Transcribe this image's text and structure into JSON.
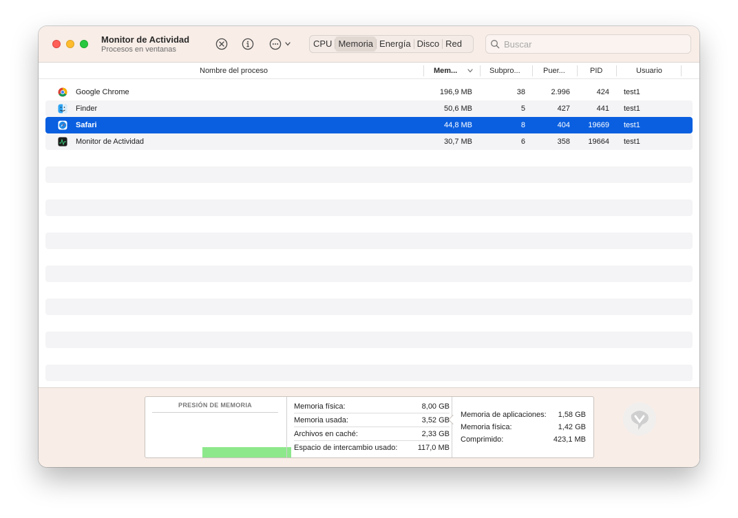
{
  "window": {
    "title": "Monitor de Actividad",
    "subtitle": "Procesos en ventanas"
  },
  "toolbar": {
    "stop_icon": "x-circle-icon",
    "info_icon": "info-circle-icon",
    "more_icon": "ellipsis-circle-icon",
    "tabs": [
      {
        "label": "CPU",
        "active": false
      },
      {
        "label": "Memoria",
        "active": true
      },
      {
        "label": "Energía",
        "active": false
      },
      {
        "label": "Disco",
        "active": false
      },
      {
        "label": "Red",
        "active": false
      }
    ],
    "search_placeholder": "Buscar",
    "search_value": ""
  },
  "table": {
    "columns": [
      {
        "key": "name",
        "label": "Nombre del proceso"
      },
      {
        "key": "mem",
        "label": "Mem...",
        "sorted": "descending"
      },
      {
        "key": "threads",
        "label": "Subpro..."
      },
      {
        "key": "ports",
        "label": "Puer..."
      },
      {
        "key": "pid",
        "label": "PID"
      },
      {
        "key": "user",
        "label": "Usuario"
      }
    ],
    "rows": [
      {
        "icon": "chrome-icon",
        "name": "Google Chrome",
        "mem": "196,9 MB",
        "threads": "38",
        "ports": "2.996",
        "pid": "424",
        "user": "test1",
        "selected": false
      },
      {
        "icon": "finder-icon",
        "name": "Finder",
        "mem": "50,6 MB",
        "threads": "5",
        "ports": "427",
        "pid": "441",
        "user": "test1",
        "selected": false
      },
      {
        "icon": "safari-icon",
        "name": "Safari",
        "mem": "44,8 MB",
        "threads": "8",
        "ports": "404",
        "pid": "19669",
        "user": "test1",
        "selected": true
      },
      {
        "icon": "activity-monitor-icon",
        "name": "Monitor de Actividad",
        "mem": "30,7 MB",
        "threads": "6",
        "ports": "358",
        "pid": "19664",
        "user": "test1",
        "selected": false
      }
    ]
  },
  "footer": {
    "pressure_title": "PRESIÓN DE MEMORIA",
    "pressure_color": "#8de88b",
    "stats": [
      {
        "label": "Memoria física:",
        "value": "8,00 GB"
      },
      {
        "label": "Memoria usada:",
        "value": "3,52 GB"
      },
      {
        "label": "Archivos en caché:",
        "value": "2,33 GB"
      },
      {
        "label": "Espacio de intercambio usado:",
        "value": "117,0 MB"
      }
    ],
    "breakdown": [
      {
        "label": "Memoria de aplicaciones:",
        "value": "1,58 GB"
      },
      {
        "label": "Memoria física:",
        "value": "1,42 GB"
      },
      {
        "label": "Comprimido:",
        "value": "423,1 MB"
      }
    ]
  },
  "colors": {
    "selection": "#0a5fe0",
    "toolbar_bg": "#f8ede7"
  }
}
